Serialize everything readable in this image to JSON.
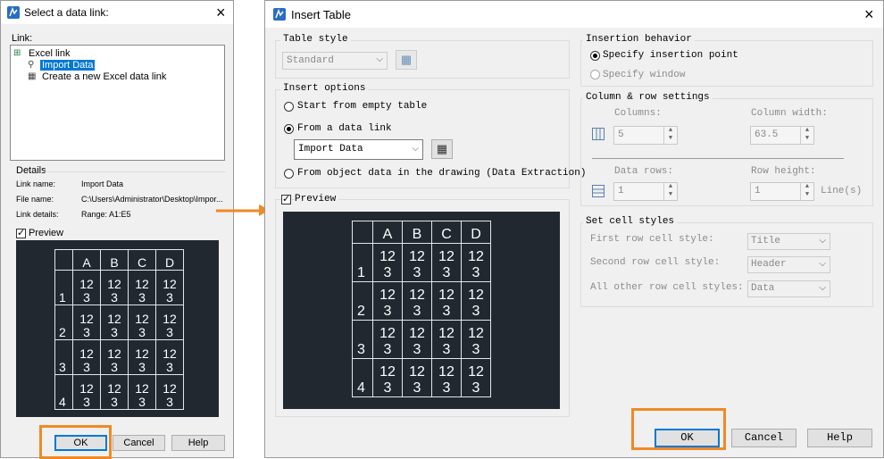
{
  "left_dialog": {
    "title": "Select a data link:",
    "link_label": "Link:",
    "tree": {
      "root": "Excel link",
      "child_selected": "Import Data",
      "child_new": "Create a new Excel data link"
    },
    "details_title": "Details",
    "details": [
      {
        "label": "Link name:",
        "value": "Import Data"
      },
      {
        "label": "File name:",
        "value": "C:\\Users\\Administrator\\Desktop\\Impor..."
      },
      {
        "label": "Link details:",
        "value": "Range: A1:E5"
      }
    ],
    "preview_label": "Preview",
    "preview_checked": true,
    "buttons": {
      "ok": "OK",
      "cancel": "Cancel",
      "help": "Help"
    }
  },
  "right_dialog": {
    "title": "Insert Table",
    "table_style": {
      "title": "Table style",
      "value": "Standard"
    },
    "insert_options": {
      "title": "Insert options",
      "start_empty": "Start from empty table",
      "from_data_link": "From a data link",
      "data_link_value": "Import Data",
      "from_object": "From object data in the drawing (Data Extraction)",
      "selected": "from_data_link"
    },
    "preview_label": "Preview",
    "preview_checked": true,
    "insertion_behavior": {
      "title": "Insertion behavior",
      "specify_point": "Specify insertion point",
      "specify_window": "Specify window",
      "selected": "specify_point"
    },
    "col_row": {
      "title": "Column & row settings",
      "columns_label": "Columns:",
      "columns_value": "5",
      "col_width_label": "Column width:",
      "col_width_value": "63.5",
      "data_rows_label": "Data rows:",
      "data_rows_value": "1",
      "row_height_label": "Row height:",
      "row_height_value": "1",
      "row_height_unit": "Line(s)"
    },
    "cell_styles": {
      "title": "Set cell styles",
      "first_label": "First row cell style:",
      "first_value": "Title",
      "second_label": "Second row cell style:",
      "second_value": "Header",
      "other_label": "All other row cell styles:",
      "other_value": "Data"
    },
    "buttons": {
      "ok": "OK",
      "cancel": "Cancel",
      "help": "Help"
    }
  },
  "preview_table": {
    "headers": [
      "A",
      "B",
      "C",
      "D"
    ],
    "rows": [
      {
        "n": "1",
        "cells": [
          "12\n3",
          "12\n3",
          "12\n3",
          "12\n3"
        ]
      },
      {
        "n": "2",
        "cells": [
          "12\n3",
          "12\n3",
          "12\n3",
          "12\n3"
        ]
      },
      {
        "n": "3",
        "cells": [
          "12\n3",
          "12\n3",
          "12\n3",
          "12\n3"
        ]
      },
      {
        "n": "4",
        "cells": [
          "12\n3",
          "12\n3",
          "12\n3",
          "12\n3"
        ]
      }
    ]
  },
  "colors": {
    "highlight": "#ef8a25",
    "preview_bg": "#212830",
    "selection": "#0078d7"
  }
}
